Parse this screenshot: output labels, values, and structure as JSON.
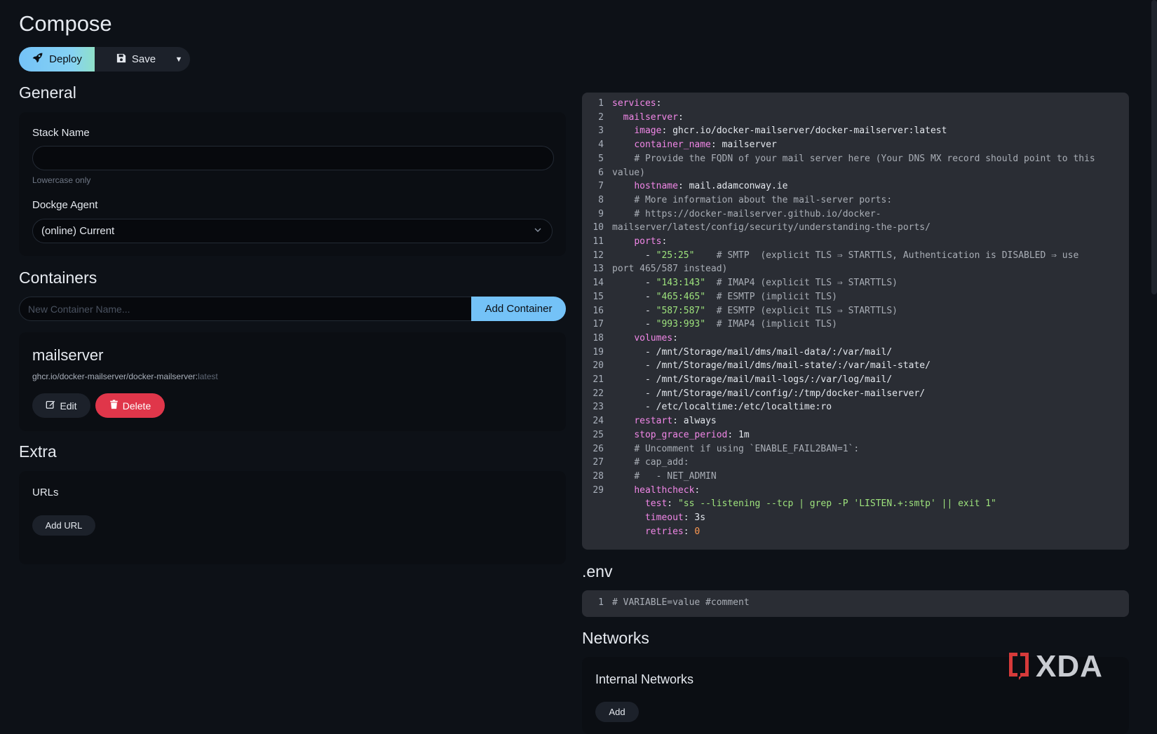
{
  "page": {
    "title": "Compose"
  },
  "toolbar": {
    "deploy_label": "Deploy",
    "save_label": "Save"
  },
  "general": {
    "title": "General",
    "stack_name_label": "Stack Name",
    "stack_name_value": "",
    "stack_name_hint": "Lowercase only",
    "agent_label": "Dockge Agent",
    "agent_value": "(online) Current"
  },
  "containers": {
    "title": "Containers",
    "new_placeholder": "New Container Name...",
    "add_label": "Add Container",
    "item": {
      "name": "mailserver",
      "image": "ghcr.io/docker-mailserver/docker-mailserver:",
      "tag": "latest",
      "edit_label": "Edit",
      "delete_label": "Delete"
    }
  },
  "extra": {
    "title": "Extra",
    "urls_label": "URLs",
    "add_url_label": "Add URL"
  },
  "compose_yaml": {
    "lines": [
      {
        "n": "1",
        "t": [
          [
            "k",
            "services"
          ],
          [
            "v",
            ":"
          ]
        ]
      },
      {
        "n": "2",
        "t": [
          [
            "v",
            "  "
          ],
          [
            "k",
            "mailserver"
          ],
          [
            "v",
            ":"
          ]
        ]
      },
      {
        "n": "3",
        "t": [
          [
            "v",
            "    "
          ],
          [
            "k",
            "image"
          ],
          [
            "v",
            ": ghcr.io/docker-mailserver/docker-mailserver:latest"
          ]
        ]
      },
      {
        "n": "4",
        "t": [
          [
            "v",
            "    "
          ],
          [
            "k",
            "container_name"
          ],
          [
            "v",
            ": mailserver"
          ]
        ]
      },
      {
        "n": "5",
        "t": [
          [
            "v",
            "    "
          ],
          [
            "c",
            "# Provide the FQDN of your mail server here (Your DNS MX record should point to this"
          ]
        ]
      },
      {
        "n": "6",
        "t": [
          [
            "c",
            "value)"
          ]
        ]
      },
      {
        "n": "7",
        "t": [
          [
            "v",
            "    "
          ],
          [
            "k",
            "hostname"
          ],
          [
            "v",
            ": mail.adamconway.ie"
          ]
        ]
      },
      {
        "n": "8",
        "t": [
          [
            "v",
            "    "
          ],
          [
            "c",
            "# More information about the mail-server ports:"
          ]
        ]
      },
      {
        "n": "9",
        "t": [
          [
            "v",
            "    "
          ],
          [
            "c",
            "# https://docker-mailserver.github.io/docker-"
          ]
        ]
      },
      {
        "n": "10",
        "t": [
          [
            "c",
            "mailserver/latest/config/security/understanding-the-ports/"
          ]
        ]
      },
      {
        "n": "11",
        "t": [
          [
            "v",
            "    "
          ],
          [
            "k",
            "ports"
          ],
          [
            "v",
            ":"
          ]
        ]
      },
      {
        "n": "12",
        "t": [
          [
            "v",
            "      - "
          ],
          [
            "s",
            "\"25:25\""
          ],
          [
            "c",
            "    # SMTP  (explicit TLS ⇒ STARTTLS, Authentication is DISABLED ⇒ use"
          ]
        ]
      },
      {
        "n": "13",
        "t": [
          [
            "c",
            "port 465/587 instead)"
          ]
        ]
      },
      {
        "n": "14",
        "t": [
          [
            "v",
            "      - "
          ],
          [
            "s",
            "\"143:143\""
          ],
          [
            "c",
            "  # IMAP4 (explicit TLS ⇒ STARTTLS)"
          ]
        ]
      },
      {
        "n": "15",
        "t": [
          [
            "v",
            "      - "
          ],
          [
            "s",
            "\"465:465\""
          ],
          [
            "c",
            "  # ESMTP (implicit TLS)"
          ]
        ]
      },
      {
        "n": "16",
        "t": [
          [
            "v",
            "      - "
          ],
          [
            "s",
            "\"587:587\""
          ],
          [
            "c",
            "  # ESMTP (explicit TLS ⇒ STARTTLS)"
          ]
        ]
      },
      {
        "n": "17",
        "t": [
          [
            "v",
            "      - "
          ],
          [
            "s",
            "\"993:993\""
          ],
          [
            "c",
            "  # IMAP4 (implicit TLS)"
          ]
        ]
      },
      {
        "n": "18",
        "t": [
          [
            "v",
            "    "
          ],
          [
            "k",
            "volumes"
          ],
          [
            "v",
            ":"
          ]
        ]
      },
      {
        "n": "19",
        "t": [
          [
            "v",
            "      - /mnt/Storage/mail/dms/mail-data/:/var/mail/"
          ]
        ]
      },
      {
        "n": "20",
        "t": [
          [
            "v",
            "      - /mnt/Storage/mail/dms/mail-state/:/var/mail-state/"
          ]
        ]
      },
      {
        "n": "21",
        "t": [
          [
            "v",
            "      - /mnt/Storage/mail/mail-logs/:/var/log/mail/"
          ]
        ]
      },
      {
        "n": "22",
        "t": [
          [
            "v",
            "      - /mnt/Storage/mail/config/:/tmp/docker-mailserver/"
          ]
        ]
      },
      {
        "n": "23",
        "t": [
          [
            "v",
            "      - /etc/localtime:/etc/localtime:ro"
          ]
        ]
      },
      {
        "n": "24",
        "t": [
          [
            "v",
            "    "
          ],
          [
            "k",
            "restart"
          ],
          [
            "v",
            ": always"
          ]
        ]
      },
      {
        "n": "25",
        "t": [
          [
            "v",
            "    "
          ],
          [
            "k",
            "stop_grace_period"
          ],
          [
            "v",
            ": 1m"
          ]
        ]
      },
      {
        "n": "26",
        "t": [
          [
            "v",
            "    "
          ],
          [
            "c",
            "# Uncomment if using `ENABLE_FAIL2BAN=1`:"
          ]
        ]
      },
      {
        "n": "27",
        "t": [
          [
            "v",
            "    "
          ],
          [
            "c",
            "# cap_add:"
          ]
        ]
      },
      {
        "n": "28",
        "t": [
          [
            "v",
            "    "
          ],
          [
            "c",
            "#   - NET_ADMIN"
          ]
        ]
      },
      {
        "n": "29",
        "t": [
          [
            "v",
            "    "
          ],
          [
            "k",
            "healthcheck"
          ],
          [
            "v",
            ":"
          ]
        ]
      },
      {
        "n": "",
        "t": [
          [
            "v",
            "      "
          ],
          [
            "k",
            "test"
          ],
          [
            "v",
            ": "
          ],
          [
            "s",
            "\"ss --listening --tcp | grep -P 'LISTEN.+:smtp' || exit 1\""
          ]
        ]
      },
      {
        "n": "",
        "t": [
          [
            "v",
            "      "
          ],
          [
            "k",
            "timeout"
          ],
          [
            "v",
            ": 3s"
          ]
        ]
      },
      {
        "n": "",
        "t": [
          [
            "v",
            "      "
          ],
          [
            "k",
            "retries"
          ],
          [
            "v",
            ": "
          ],
          [
            "n",
            "0"
          ]
        ]
      }
    ]
  },
  "env": {
    "title": ".env",
    "line_number": "1",
    "line_text": "# VARIABLE=value #comment"
  },
  "networks": {
    "title": "Networks",
    "internal_title": "Internal Networks",
    "add_label": "Add"
  },
  "watermark": {
    "text": "XDA"
  }
}
